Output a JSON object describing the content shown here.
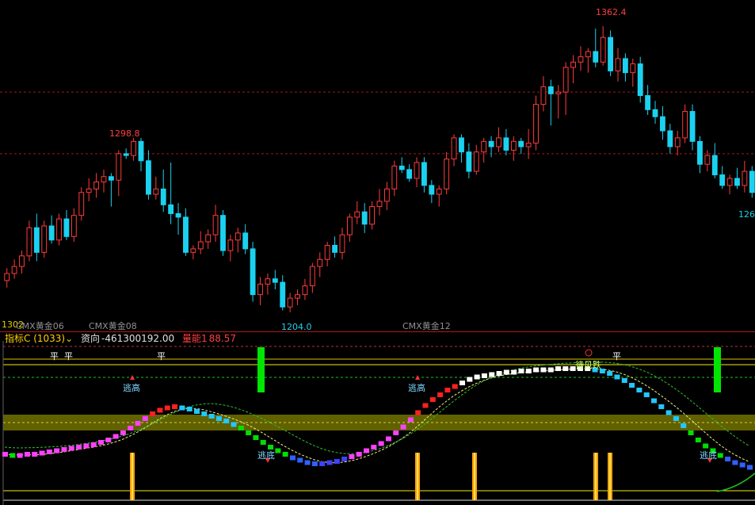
{
  "colors": {
    "up": "#ff3b3b",
    "down": "#1ad2f0",
    "ma": "#ffff00",
    "signal_green": "#00e600",
    "signal_orange": "#ffa000",
    "band": "#6b6b00"
  },
  "price_panel": {
    "high_label": "1362.4",
    "high2_label": "1298.8",
    "low_label": "1204.0",
    "right_label": "126",
    "left_label": "1302"
  },
  "contracts": [
    "CMX黄金06",
    "CMX黄金08",
    "CMX黄金12"
  ],
  "indicator_bar": {
    "name": "指标C (1033)",
    "dropdown_arrow": "⌄",
    "field1_label": "资向",
    "field1_value": "-461300192.00",
    "field2_label": "量能1",
    "field2_value": "88.57"
  },
  "indicator_labels": {
    "flat": "平",
    "escape_high": "逃高",
    "escape_low": "逃底",
    "wait": "待见跌"
  },
  "chart_data": [
    {
      "type": "candlestick",
      "title": "",
      "x_labels": [
        "CMX黄金06",
        "CMX黄金08",
        "CMX黄金12"
      ],
      "ylim": [
        1195,
        1375
      ],
      "annotations": [
        {
          "label": "1362.4",
          "value": 1362.4
        },
        {
          "label": "1298.8",
          "value": 1298.8
        },
        {
          "label": "1204.0",
          "value": 1204.0
        }
      ],
      "ohlc": [
        [
          1218,
          1225,
          1214,
          1222
        ],
        [
          1222,
          1230,
          1219,
          1226
        ],
        [
          1226,
          1235,
          1222,
          1232
        ],
        [
          1232,
          1252,
          1229,
          1248
        ],
        [
          1248,
          1256,
          1229,
          1234
        ],
        [
          1234,
          1252,
          1231,
          1249
        ],
        [
          1249,
          1255,
          1239,
          1241
        ],
        [
          1241,
          1256,
          1238,
          1253
        ],
        [
          1253,
          1258,
          1241,
          1243
        ],
        [
          1243,
          1259,
          1240,
          1255
        ],
        [
          1255,
          1271,
          1252,
          1268
        ],
        [
          1268,
          1276,
          1263,
          1270
        ],
        [
          1270,
          1279,
          1265,
          1274
        ],
        [
          1274,
          1281,
          1268,
          1277
        ],
        [
          1277,
          1279,
          1260,
          1275
        ],
        [
          1275,
          1292,
          1266,
          1290
        ],
        [
          1290,
          1293,
          1287,
          1289
        ],
        [
          1289,
          1299,
          1286,
          1297
        ],
        [
          1297,
          1299,
          1280,
          1286
        ],
        [
          1286,
          1292,
          1264,
          1267
        ],
        [
          1267,
          1277,
          1264,
          1270
        ],
        [
          1270,
          1281,
          1257,
          1261
        ],
        [
          1261,
          1285,
          1250,
          1256
        ],
        [
          1256,
          1262,
          1244,
          1254
        ],
        [
          1254,
          1259,
          1232,
          1234
        ],
        [
          1234,
          1238,
          1230,
          1236
        ],
        [
          1236,
          1246,
          1233,
          1240
        ],
        [
          1240,
          1247,
          1236,
          1244
        ],
        [
          1244,
          1261,
          1240,
          1255
        ],
        [
          1255,
          1258,
          1232,
          1235
        ],
        [
          1235,
          1244,
          1229,
          1241
        ],
        [
          1241,
          1248,
          1234,
          1245
        ],
        [
          1245,
          1250,
          1233,
          1236
        ],
        [
          1236,
          1240,
          1206,
          1210
        ],
        [
          1210,
          1220,
          1204,
          1216
        ],
        [
          1216,
          1222,
          1210,
          1219
        ],
        [
          1219,
          1224,
          1213,
          1217
        ],
        [
          1217,
          1221,
          1201,
          1203
        ],
        [
          1203,
          1211,
          1200,
          1208
        ],
        [
          1208,
          1213,
          1204,
          1210
        ],
        [
          1210,
          1219,
          1207,
          1215
        ],
        [
          1215,
          1228,
          1211,
          1226
        ],
        [
          1226,
          1234,
          1220,
          1230
        ],
        [
          1230,
          1240,
          1226,
          1238
        ],
        [
          1238,
          1243,
          1231,
          1234
        ],
        [
          1234,
          1248,
          1230,
          1244
        ],
        [
          1244,
          1256,
          1240,
          1254
        ],
        [
          1254,
          1263,
          1250,
          1257
        ],
        [
          1257,
          1262,
          1245,
          1250
        ],
        [
          1250,
          1263,
          1247,
          1260
        ],
        [
          1260,
          1270,
          1255,
          1263
        ],
        [
          1263,
          1274,
          1258,
          1270
        ],
        [
          1270,
          1286,
          1266,
          1283
        ],
        [
          1283,
          1288,
          1279,
          1281
        ],
        [
          1281,
          1284,
          1274,
          1276
        ],
        [
          1276,
          1288,
          1271,
          1285
        ],
        [
          1285,
          1288,
          1268,
          1272
        ],
        [
          1272,
          1275,
          1262,
          1267
        ],
        [
          1267,
          1272,
          1260,
          1270
        ],
        [
          1270,
          1291,
          1267,
          1287
        ],
        [
          1287,
          1301,
          1283,
          1299
        ],
        [
          1299,
          1301,
          1285,
          1291
        ],
        [
          1291,
          1296,
          1276,
          1280
        ],
        [
          1280,
          1295,
          1278,
          1291
        ],
        [
          1291,
          1299,
          1285,
          1297
        ],
        [
          1297,
          1300,
          1288,
          1294
        ],
        [
          1294,
          1305,
          1291,
          1299
        ],
        [
          1299,
          1304,
          1289,
          1292
        ],
        [
          1292,
          1300,
          1286,
          1297
        ],
        [
          1297,
          1299,
          1290,
          1294
        ],
        [
          1294,
          1304,
          1287,
          1296
        ],
        [
          1296,
          1323,
          1292,
          1318
        ],
        [
          1318,
          1334,
          1314,
          1328
        ],
        [
          1328,
          1332,
          1306,
          1324
        ],
        [
          1324,
          1329,
          1310,
          1325
        ],
        [
          1325,
          1342,
          1312,
          1339
        ],
        [
          1339,
          1346,
          1330,
          1342
        ],
        [
          1342,
          1351,
          1337,
          1345
        ],
        [
          1345,
          1350,
          1336,
          1348
        ],
        [
          1348,
          1361,
          1339,
          1342
        ],
        [
          1342,
          1362.4,
          1340,
          1356
        ],
        [
          1356,
          1360,
          1334,
          1337
        ],
        [
          1337,
          1350,
          1331,
          1344
        ],
        [
          1344,
          1347,
          1331,
          1336
        ],
        [
          1336,
          1344,
          1328,
          1341
        ],
        [
          1341,
          1345,
          1319,
          1323
        ],
        [
          1323,
          1329,
          1312,
          1315
        ],
        [
          1315,
          1320,
          1307,
          1311
        ],
        [
          1311,
          1317,
          1298,
          1303
        ],
        [
          1303,
          1307,
          1290,
          1294
        ],
        [
          1294,
          1303,
          1289,
          1299
        ],
        [
          1299,
          1318,
          1296,
          1314
        ],
        [
          1314,
          1318,
          1292,
          1297
        ],
        [
          1297,
          1300,
          1279,
          1284
        ],
        [
          1284,
          1292,
          1280,
          1289
        ],
        [
          1289,
          1296,
          1276,
          1278
        ],
        [
          1278,
          1283,
          1270,
          1272
        ],
        [
          1272,
          1278,
          1267,
          1276
        ],
        [
          1276,
          1282,
          1270,
          1272
        ],
        [
          1272,
          1286,
          1268,
          1280
        ],
        [
          1280,
          1283,
          1265,
          1268
        ]
      ]
    },
    {
      "type": "indicator",
      "title": "指标C (1033)",
      "values": [
        -2,
        -3,
        -3,
        -2,
        -2,
        -1,
        0,
        1,
        2,
        3,
        4,
        5,
        6,
        8,
        10,
        13,
        16,
        20,
        24,
        28,
        32,
        35,
        37,
        38,
        37,
        36,
        34,
        32,
        30,
        28,
        26,
        23,
        20,
        16,
        12,
        8,
        4,
        1,
        -2,
        -5,
        -7,
        -9,
        -10,
        -10,
        -9,
        -8,
        -6,
        -4,
        -2,
        1,
        4,
        7,
        11,
        16,
        21,
        27,
        33,
        39,
        44,
        48,
        52,
        55,
        58,
        61,
        63,
        64,
        65,
        66,
        67,
        67,
        68,
        68,
        69,
        69,
        69,
        70,
        70,
        70,
        70,
        70,
        69,
        68,
        66,
        63,
        60,
        56,
        52,
        48,
        43,
        38,
        33,
        28,
        22,
        16,
        10,
        5,
        1,
        -3,
        -6,
        -9,
        -11,
        -13
      ]
    }
  ]
}
